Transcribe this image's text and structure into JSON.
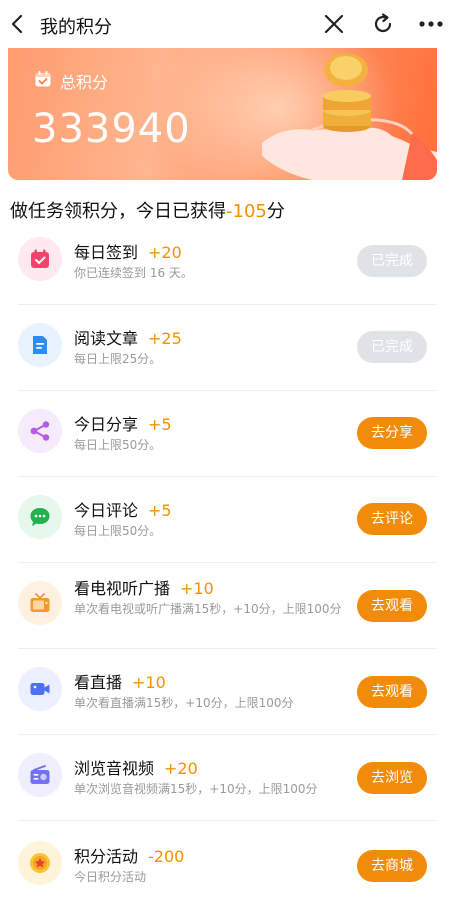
{
  "header": {
    "title": "我的积分",
    "back_icon": "chevron-left-icon",
    "close_icon": "close-icon",
    "refresh_icon": "refresh-icon",
    "more_icon": "more-dots-icon"
  },
  "banner": {
    "label": "总积分",
    "total": "333940",
    "gradient_colors": [
      "#ff9b6e",
      "#ff6f3a"
    ]
  },
  "heading": {
    "prefix": "做任务领积分，今日已获得",
    "value": "-105",
    "suffix": "分"
  },
  "tasks": [
    {
      "name": "每日签到",
      "points": "+20",
      "desc": "你已连续签到 16 天。",
      "button": "已完成",
      "status": "done",
      "icon": "calendar-check-icon"
    },
    {
      "name": "阅读文章",
      "points": "+25",
      "desc": "每日上限25分。",
      "button": "已完成",
      "status": "done",
      "icon": "document-icon"
    },
    {
      "name": "今日分享",
      "points": "+5",
      "desc": "每日上限50分。",
      "button": "去分享",
      "status": "todo",
      "icon": "share-icon"
    },
    {
      "name": "今日评论",
      "points": "+5",
      "desc": "每日上限50分。",
      "button": "去评论",
      "status": "todo",
      "icon": "comment-icon"
    },
    {
      "name": "看电视听广播",
      "points": "+10",
      "desc": "单次看电视或听广播满15秒，+10分，上限100分",
      "button": "去观看",
      "status": "todo",
      "icon": "tv-icon"
    },
    {
      "name": "看直播",
      "points": "+10",
      "desc": "单次看直播满15秒，+10分，上限100分",
      "button": "去观看",
      "status": "todo",
      "icon": "video-camera-icon"
    },
    {
      "name": "浏览音视频",
      "points": "+20",
      "desc": "单次浏览音视频满15秒，+10分，上限100分",
      "button": "去浏览",
      "status": "todo",
      "icon": "radio-icon"
    },
    {
      "name": "积分活动",
      "points": "-200",
      "desc": "今日积分活动",
      "button": "去商城",
      "status": "todo",
      "icon": "star-medal-icon"
    }
  ],
  "colors": {
    "accent": "#f39200",
    "button": "#f18c0b",
    "done_button": "#dfe2e7"
  }
}
